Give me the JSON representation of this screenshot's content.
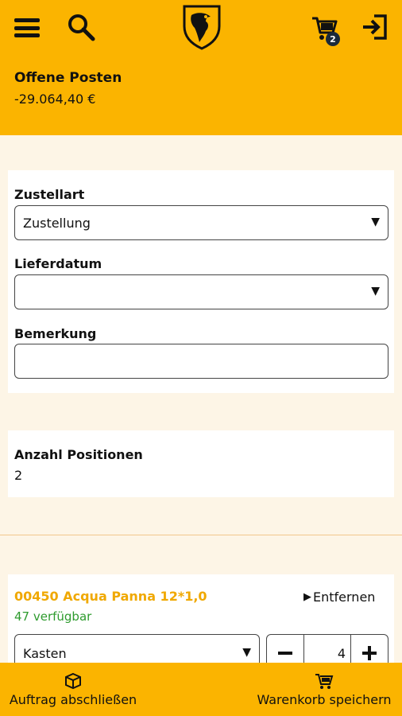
{
  "header": {
    "menu_icon": "hamburger-menu-icon",
    "search_icon": "search-icon",
    "logo_icon": "shield-eagle-logo",
    "cart_icon": "shopping-cart-icon",
    "cart_badge": "2",
    "logout_icon": "logout-icon",
    "offene_posten_label": "Offene Posten",
    "offene_posten_value": "-29.064,40 €",
    "color": "#fbb400"
  },
  "order_form": {
    "zustellart_label": "Zustellart",
    "zustellart_value": "Zustellung",
    "lieferdatum_label": "Lieferdatum",
    "lieferdatum_value": "",
    "bemerkung_label": "Bemerkung",
    "bemerkung_value": ""
  },
  "summary": {
    "anzahl_label": "Anzahl Positionen",
    "anzahl_value": "2"
  },
  "items": [
    {
      "name": "00450 Acqua Panna 12*1,0",
      "availability": "47 verfügbar",
      "remove_label": "Entfernen",
      "unit": "Kasten",
      "quantity": "4"
    }
  ],
  "footer": {
    "complete_label": "Auftrag abschließen",
    "complete_icon": "box-icon",
    "save_label": "Warenkorb speichern",
    "save_icon": "cart-icon"
  },
  "colors": {
    "accent": "#fbb400",
    "product_name": "#f0a800",
    "available": "#2e9b2e"
  }
}
